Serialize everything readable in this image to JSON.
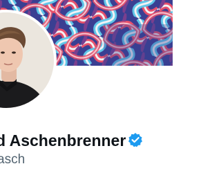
{
  "profile": {
    "display_name": "d Aschenbrenner",
    "handle": "asch",
    "verified": true,
    "verified_badge_icon": "verified-badge-icon",
    "verified_color": "#1d9bf0"
  },
  "banner": {
    "pattern": "interlocking-knot-pattern",
    "colors": [
      "#3a3f92",
      "#e8506b",
      "#5fc6e8",
      "#f2f2f5",
      "#7a3f8e"
    ]
  },
  "avatar": {
    "description_icon": "profile-photo"
  },
  "colors": {
    "name_text": "#0f1419",
    "handle_text": "#536471",
    "background": "#ffffff"
  }
}
